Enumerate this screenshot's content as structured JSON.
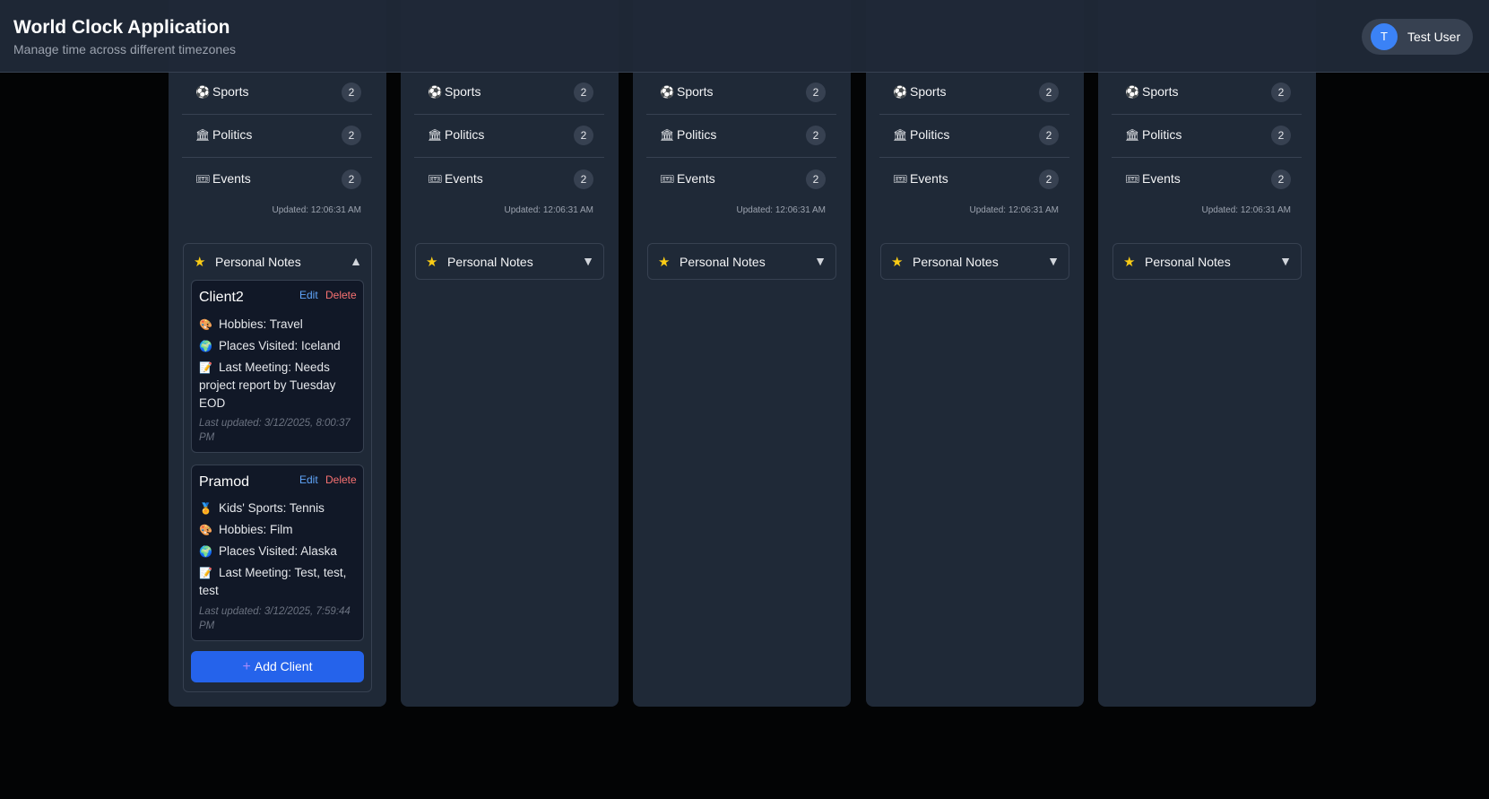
{
  "header": {
    "title": "World Clock Application",
    "subtitle": "Manage time across different timezones"
  },
  "user": {
    "initial": "T",
    "name": "Test User"
  },
  "colors": {
    "background": "#030405",
    "panel": "#1f2937",
    "card": "#111827",
    "accent_blue": "#2563eb",
    "edit_link": "#60a5fa",
    "delete_link": "#f87171",
    "star": "#facc15"
  },
  "columns": [
    {
      "categories": [
        {
          "icon": "soccer-ball-icon",
          "label": "Sports",
          "count": "2"
        },
        {
          "icon": "classical-building-icon",
          "label": "Politics",
          "count": "2"
        },
        {
          "icon": "ticket-icon",
          "label": "Events",
          "count": "2"
        }
      ],
      "updated": "Updated: 12:06:31 AM",
      "notes_title": "Personal Notes",
      "notes_expanded": true
    },
    {
      "categories": [
        {
          "icon": "soccer-ball-icon",
          "label": "Sports",
          "count": "2"
        },
        {
          "icon": "classical-building-icon",
          "label": "Politics",
          "count": "2"
        },
        {
          "icon": "ticket-icon",
          "label": "Events",
          "count": "2"
        }
      ],
      "updated": "Updated: 12:06:31 AM",
      "notes_title": "Personal Notes",
      "notes_expanded": false
    },
    {
      "categories": [
        {
          "icon": "soccer-ball-icon",
          "label": "Sports",
          "count": "2"
        },
        {
          "icon": "classical-building-icon",
          "label": "Politics",
          "count": "2"
        },
        {
          "icon": "ticket-icon",
          "label": "Events",
          "count": "2"
        }
      ],
      "updated": "Updated: 12:06:31 AM",
      "notes_title": "Personal Notes",
      "notes_expanded": false
    },
    {
      "categories": [
        {
          "icon": "soccer-ball-icon",
          "label": "Sports",
          "count": "2"
        },
        {
          "icon": "classical-building-icon",
          "label": "Politics",
          "count": "2"
        },
        {
          "icon": "ticket-icon",
          "label": "Events",
          "count": "2"
        }
      ],
      "updated": "Updated: 12:06:31 AM",
      "notes_title": "Personal Notes",
      "notes_expanded": false
    },
    {
      "categories": [
        {
          "icon": "soccer-ball-icon",
          "label": "Sports",
          "count": "2"
        },
        {
          "icon": "classical-building-icon",
          "label": "Politics",
          "count": "2"
        },
        {
          "icon": "ticket-icon",
          "label": "Events",
          "count": "2"
        }
      ],
      "updated": "Updated: 12:06:31 AM",
      "notes_title": "Personal Notes",
      "notes_expanded": false
    }
  ],
  "clients": [
    {
      "name": "Client2",
      "edit": "Edit",
      "delete": "Delete",
      "details": [
        {
          "icon": "palette-icon",
          "text": "Hobbies: Travel"
        },
        {
          "icon": "globe-icon",
          "text": "Places Visited: Iceland"
        },
        {
          "icon": "memo-icon",
          "text": "Last Meeting: Needs project report by Tuesday EOD"
        }
      ],
      "last_updated": "Last updated: 3/12/2025, 8:00:37 PM"
    },
    {
      "name": "Pramod",
      "edit": "Edit",
      "delete": "Delete",
      "details": [
        {
          "icon": "medal-icon",
          "text": "Kids' Sports: Tennis"
        },
        {
          "icon": "palette-icon",
          "text": "Hobbies: Film"
        },
        {
          "icon": "globe-icon",
          "text": "Places Visited: Alaska"
        },
        {
          "icon": "memo-icon",
          "text": "Last Meeting: Test, test, test"
        }
      ],
      "last_updated": "Last updated: 3/12/2025, 7:59:44 PM"
    }
  ],
  "add_client_label": "Add Client"
}
